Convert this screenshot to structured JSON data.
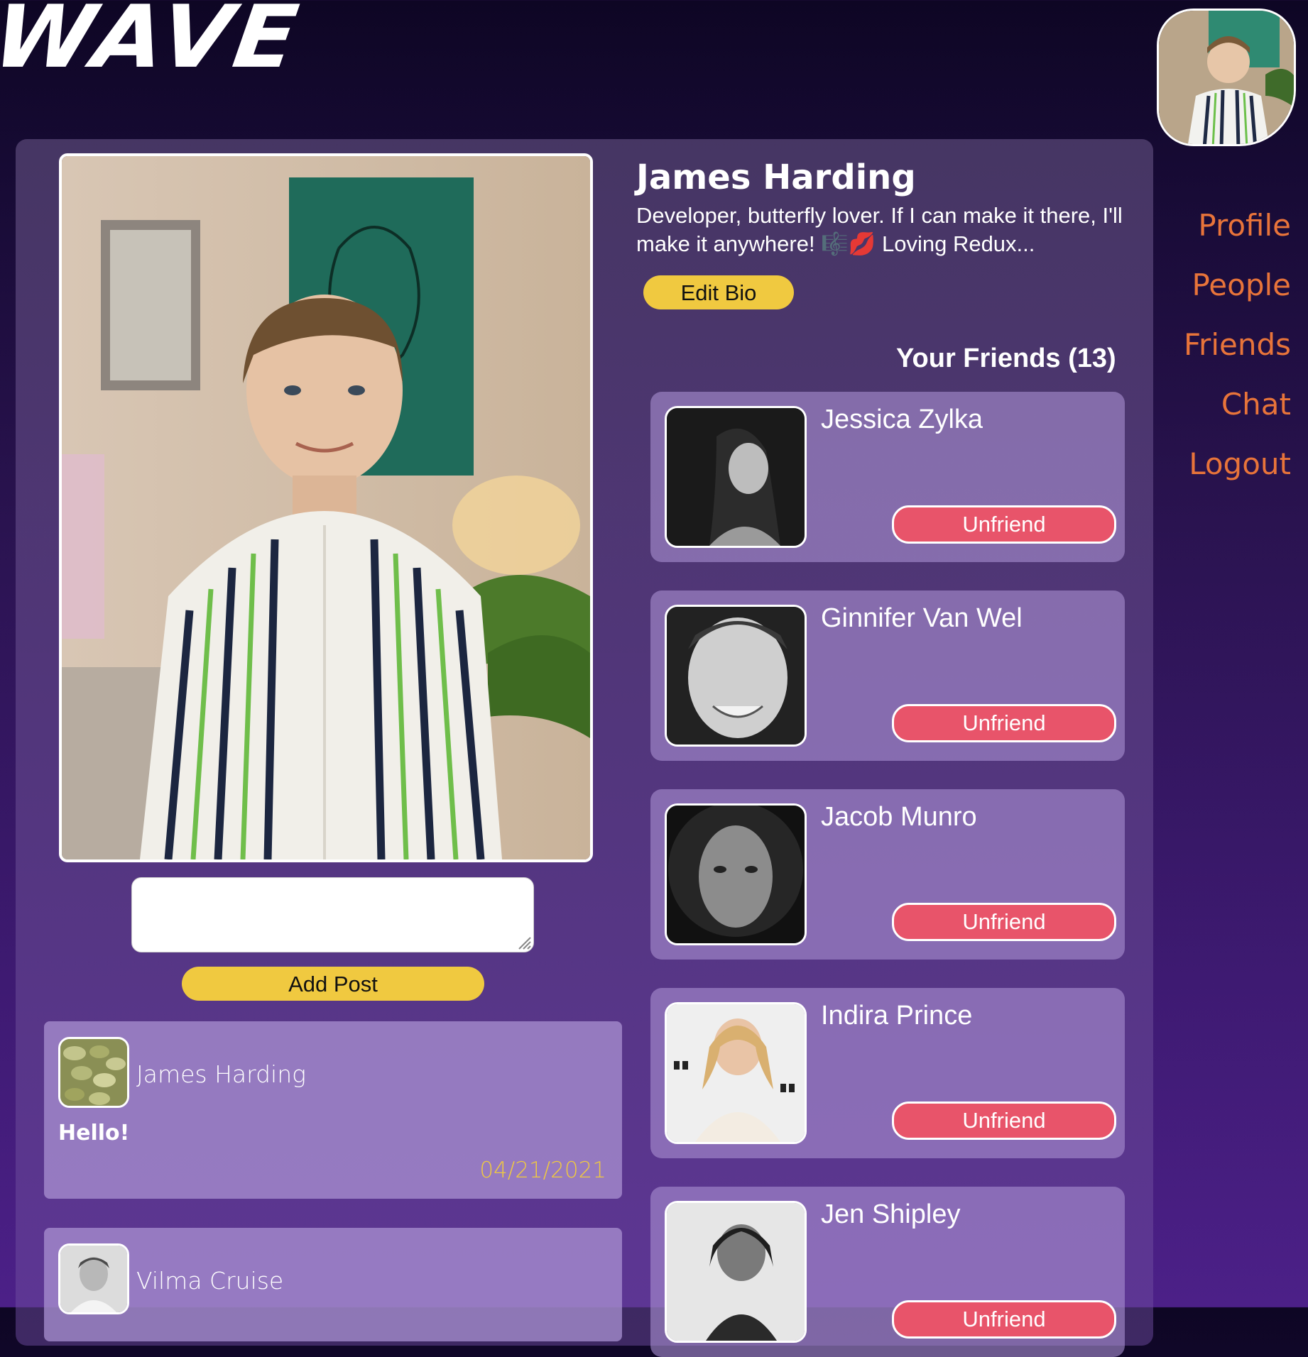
{
  "app": {
    "logo": "WAVE"
  },
  "nav": {
    "items": [
      {
        "label": "Profile"
      },
      {
        "label": "People"
      },
      {
        "label": "Friends"
      },
      {
        "label": "Chat"
      },
      {
        "label": "Logout"
      }
    ],
    "accent": "#e8743a"
  },
  "profile": {
    "name": "James Harding",
    "bio": "Developer, butterfly lover. If I can make it there, I'll make it anywhere! 🎼💋 Loving Redux...",
    "edit_bio_label": "Edit Bio"
  },
  "composer": {
    "value": "",
    "placeholder": "",
    "add_post_label": "Add Post"
  },
  "posts": [
    {
      "author": "James Harding",
      "body": "Hello!",
      "date": "04/21/2021",
      "thumb_icon": "cardamom-photo"
    },
    {
      "author": "Vilma Cruise",
      "body": "",
      "date": "",
      "thumb_icon": "portrait-photo"
    }
  ],
  "friends": {
    "heading": "Your Friends (13)",
    "items": [
      {
        "name": "Jessica Zylka",
        "action": "Unfriend"
      },
      {
        "name": "Ginnifer Van Wel",
        "action": "Unfriend"
      },
      {
        "name": "Jacob Munro",
        "action": "Unfriend"
      },
      {
        "name": "Indira Prince",
        "action": "Unfriend"
      },
      {
        "name": "Jen Shipley",
        "action": "Unfriend"
      }
    ]
  },
  "colors": {
    "yellow": "#f0c940",
    "unfriend": "#e8546a",
    "date": "#f0c940"
  }
}
